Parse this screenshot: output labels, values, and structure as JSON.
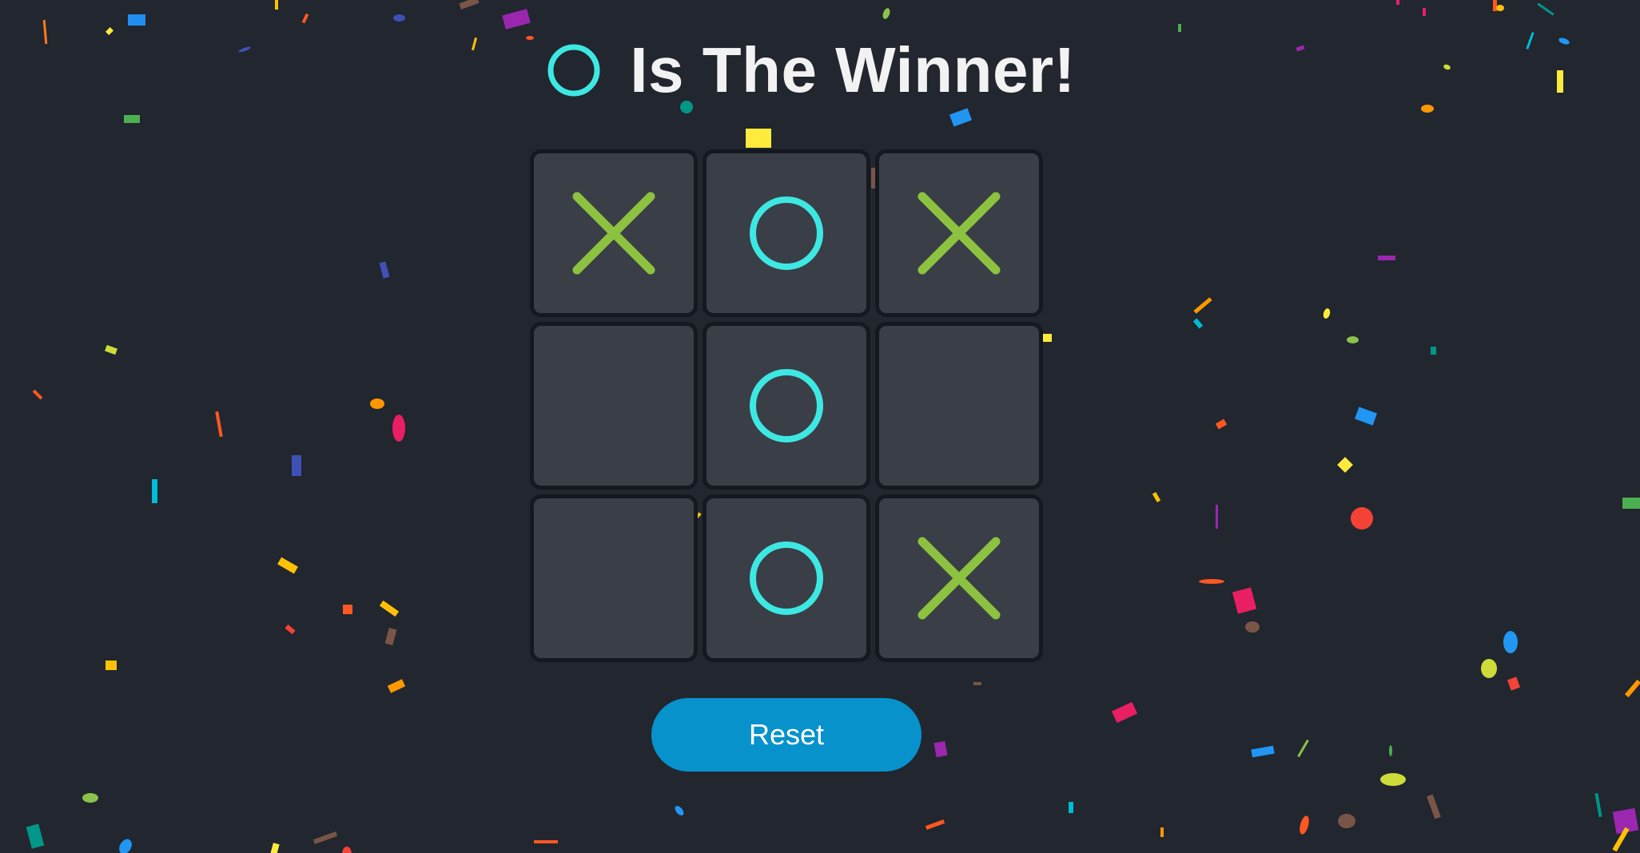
{
  "game": {
    "winner_symbol": "O",
    "winner_text": "Is The Winner!",
    "board": [
      "X",
      "O",
      "X",
      "",
      "O",
      "",
      "",
      "O",
      "X"
    ],
    "reset_label": "Reset"
  },
  "colors": {
    "background": "#21262f",
    "cell": "#3a3e47",
    "cell_border": "#14191f",
    "x_mark": "#8cc23f",
    "o_mark": "#3ee8e2",
    "title_text": "#f2f2f2",
    "reset_button": "#0792cc"
  }
}
